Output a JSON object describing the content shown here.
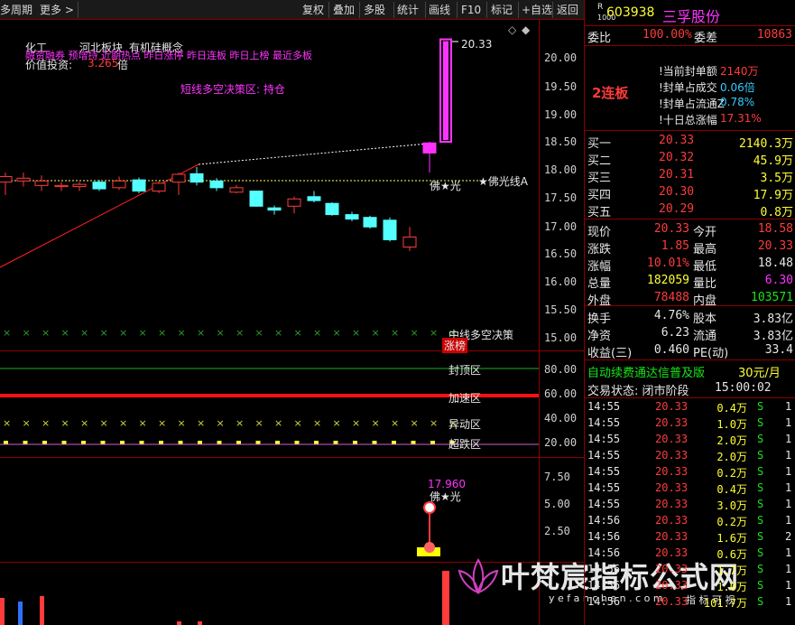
{
  "toolbar": {
    "left_items": [
      "多周期",
      "更多"
    ],
    "right_items": [
      "复权",
      "叠加",
      "多股",
      "统计",
      "画线",
      "F10",
      "标记",
      "+自选",
      "返回"
    ]
  },
  "overlay": {
    "line1": [
      "化工",
      "河北板块",
      "有机硅概念"
    ],
    "line2": "融资融券 预增持 近期热点 昨日涨停 昨日连板 昨日上榜 最近多板",
    "value_label": "价值投资:",
    "value_amount": "3.265",
    "value_unit": "倍",
    "short_strategy": "短线多空决策区: 持仓",
    "peak_price": "20.33",
    "fo_label": "佛★光",
    "fo_line": "★佛光线A",
    "mid_strategy": "中线多空决策",
    "limit_list": "涨榜",
    "zone_top": "封顶区",
    "zone_accel": "加速区",
    "zone_move": "异动区",
    "zone_oversold": "超跌区",
    "sub_peak": "17.960",
    "sub_fo": "佛★光",
    "watermark_main": "叶梵宸指标公式网",
    "watermark_url": "y e f a n c h e n . c o m",
    "watermark_sub": "指 标 可 视"
  },
  "axis": {
    "main_ticks": [
      "20.33",
      "20.00",
      "19.50",
      "19.00",
      "18.50",
      "18.00",
      "17.50",
      "17.00",
      "16.50",
      "16.00",
      "15.50",
      "15.00"
    ],
    "sub1_ticks": [
      "80.00",
      "60.00",
      "40.00",
      "20.00"
    ],
    "sub2_ticks": [
      "7.50",
      "5.00",
      "2.50"
    ]
  },
  "candles": [
    {
      "o": 17.78,
      "c": 17.88,
      "h": 17.95,
      "l": 17.55
    },
    {
      "o": 17.8,
      "c": 17.85,
      "h": 17.95,
      "l": 17.7
    },
    {
      "o": 17.72,
      "c": 17.8,
      "h": 17.9,
      "l": 17.62
    },
    {
      "o": 17.7,
      "c": 17.72,
      "h": 17.78,
      "l": 17.62
    },
    {
      "o": 17.7,
      "c": 17.74,
      "h": 17.78,
      "l": 17.62
    },
    {
      "o": 17.78,
      "c": 17.66,
      "h": 17.82,
      "l": 17.62
    },
    {
      "o": 17.68,
      "c": 17.8,
      "h": 17.88,
      "l": 17.64
    },
    {
      "o": 17.82,
      "c": 17.62,
      "h": 17.86,
      "l": 17.58
    },
    {
      "o": 17.62,
      "c": 17.76,
      "h": 17.8,
      "l": 17.58
    },
    {
      "o": 17.78,
      "c": 17.92,
      "h": 17.95,
      "l": 17.55
    },
    {
      "o": 17.93,
      "c": 17.78,
      "h": 18.05,
      "l": 17.72
    },
    {
      "o": 17.8,
      "c": 17.68,
      "h": 17.85,
      "l": 17.62
    },
    {
      "o": 17.6,
      "c": 17.68,
      "h": 17.73,
      "l": 17.58
    },
    {
      "o": 17.62,
      "c": 17.35,
      "h": 17.63,
      "l": 17.34
    },
    {
      "o": 17.32,
      "c": 17.28,
      "h": 17.36,
      "l": 17.2
    },
    {
      "o": 17.35,
      "c": 17.48,
      "h": 17.52,
      "l": 17.22
    },
    {
      "o": 17.52,
      "c": 17.45,
      "h": 17.62,
      "l": 17.42
    },
    {
      "o": 17.4,
      "c": 17.2,
      "h": 17.42,
      "l": 17.18
    },
    {
      "o": 17.2,
      "c": 17.12,
      "h": 17.25,
      "l": 17.08
    },
    {
      "o": 17.15,
      "c": 16.98,
      "h": 17.18,
      "l": 16.95
    },
    {
      "o": 17.1,
      "c": 16.75,
      "h": 17.15,
      "l": 16.72
    },
    {
      "o": 16.62,
      "c": 16.8,
      "h": 16.98,
      "l": 16.55
    },
    {
      "o": 18.3,
      "c": 18.48,
      "h": 18.5,
      "l": 17.95
    },
    {
      "o": 18.5,
      "c": 20.33,
      "h": 20.33,
      "l": 18.5
    }
  ],
  "quote": {
    "market_tag": "R",
    "code": "603938",
    "name": "三孚股份",
    "weibi_label": "委比",
    "weibi_value": "100.00%",
    "weicha_label": "委差",
    "weicha_value": "10863",
    "board_label": "2连板",
    "seal_rows": [
      {
        "label": "当前封单额",
        "value": "2140万",
        "color": "red"
      },
      {
        "label": "封单占成交",
        "value": "0.06倍",
        "color": "cyan"
      },
      {
        "label": "封单占流通Z",
        "value": "0.78%",
        "color": "cyan"
      },
      {
        "label": "十日总涨幅",
        "value": "17.31%",
        "color": "red"
      }
    ],
    "bids": [
      {
        "label": "买一",
        "price": "20.33",
        "vol": "2140.3万"
      },
      {
        "label": "买二",
        "price": "20.32",
        "vol": "45.9万"
      },
      {
        "label": "买三",
        "price": "20.31",
        "vol": "3.5万"
      },
      {
        "label": "买四",
        "price": "20.30",
        "vol": "17.9万"
      },
      {
        "label": "买五",
        "price": "20.29",
        "vol": "0.8万"
      }
    ],
    "stats": [
      {
        "l1": "现价",
        "v1": "20.33",
        "c1": "red",
        "l2": "今开",
        "v2": "18.58",
        "c2": "red"
      },
      {
        "l1": "涨跌",
        "v1": "1.85",
        "c1": "red",
        "l2": "最高",
        "v2": "20.33",
        "c2": "red"
      },
      {
        "l1": "涨幅",
        "v1": "10.01%",
        "c1": "red",
        "l2": "最低",
        "v2": "18.48",
        "c2": "white"
      },
      {
        "l1": "总量",
        "v1": "182059",
        "c1": "yellow",
        "l2": "量比",
        "v2": "6.30",
        "c2": "magenta"
      },
      {
        "l1": "外盘",
        "v1": "78488",
        "c1": "red",
        "l2": "内盘",
        "v2": "103571",
        "c2": "green"
      }
    ],
    "fin": [
      {
        "l1": "换手",
        "v1": "4.76%",
        "l2": "股本",
        "v2": "3.83亿"
      },
      {
        "l1": "净资",
        "v1": "6.23",
        "l2": "流通",
        "v2": "3.83亿"
      },
      {
        "l1": "收益(三)",
        "v1": "0.460",
        "l2": "PE(动)",
        "v2": "33.4"
      }
    ],
    "ad_text": "自动续费通达信普及版",
    "ad_price": "30元/月",
    "trade_state_label": "交易状态: 闭市阶段",
    "trade_state_time": "15:00:02",
    "ticks": [
      {
        "t": "14:55",
        "p": "20.33",
        "v": "0.4万",
        "s": "S",
        "n": "1"
      },
      {
        "t": "14:55",
        "p": "20.33",
        "v": "1.0万",
        "s": "S",
        "n": "1"
      },
      {
        "t": "14:55",
        "p": "20.33",
        "v": "2.0万",
        "s": "S",
        "n": "1"
      },
      {
        "t": "14:55",
        "p": "20.33",
        "v": "2.0万",
        "s": "S",
        "n": "1"
      },
      {
        "t": "14:55",
        "p": "20.33",
        "v": "0.2万",
        "s": "S",
        "n": "1"
      },
      {
        "t": "14:55",
        "p": "20.33",
        "v": "0.4万",
        "s": "S",
        "n": "1"
      },
      {
        "t": "14:55",
        "p": "20.33",
        "v": "3.0万",
        "s": "S",
        "n": "1"
      },
      {
        "t": "14:56",
        "p": "20.33",
        "v": "0.2万",
        "s": "S",
        "n": "1"
      },
      {
        "t": "14:56",
        "p": "20.33",
        "v": "1.6万",
        "s": "S",
        "n": "2"
      },
      {
        "t": "14:56",
        "p": "20.33",
        "v": "0.6万",
        "s": "S",
        "n": "1"
      },
      {
        "t": "14:56",
        "p": "20.33",
        "v": "1.7万",
        "s": "S",
        "n": "1"
      },
      {
        "t": "14:56",
        "p": "20.33",
        "v": "1.0万",
        "s": "S",
        "n": "1"
      },
      {
        "t": "14:56",
        "p": "20.33",
        "v": "101.7万",
        "s": "S",
        "n": "1"
      }
    ]
  },
  "colors": {
    "up": "#ff3b3b",
    "down": "#54ffff",
    "limit": "#ff33ff",
    "bg": "#000000",
    "frame": "#8b0000"
  }
}
